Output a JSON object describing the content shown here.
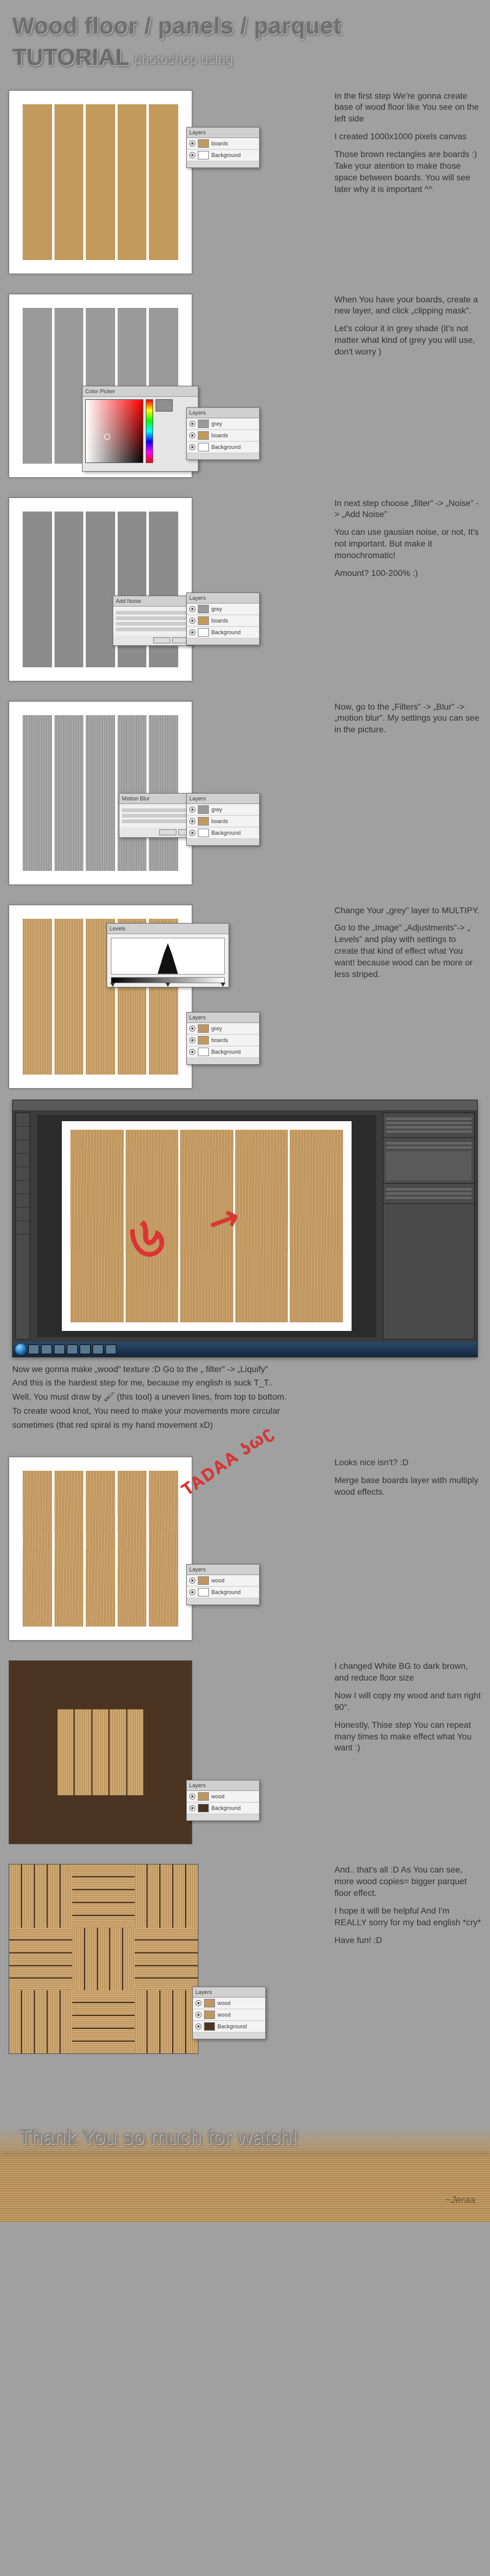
{
  "header": {
    "line1": "Wood floor / panels / parquet",
    "line2": "TUTORIAL",
    "sub": "photoshop using"
  },
  "steps": {
    "s1": {
      "p1": "In the first step We're gonna create base of wood floor like You see on the left side",
      "p2": "I created 1000x1000 pixels canvas",
      "p3": "Those brown rectangles are boards :) Take your atention to make those space between boards. You will see later why it is important ^^"
    },
    "s2": {
      "p1": "When You have your boards, create a new layer, and click „clipping mask”.",
      "p2": "Let's colour it in grey shade (it's not matter what kind of grey you will use, don't worry )"
    },
    "s3": {
      "p1": "In next step choose „filter” -> „Noise” -> „Add Noise”",
      "p2": "You can use gausian noise, or not, It's not important. But make it monochromatic!",
      "p3": "Amount? 100-200% :)"
    },
    "s4": {
      "p1": "Now, go to the „Filters” -> „Blur” -> „motion blur”. My settings you can see in the picture."
    },
    "s5": {
      "p1": "Change Your „grey” layer to MULTIPY.",
      "p2": "Go to the „Image” „Adjustments”-> „ Levels” and play with settings to create that kind of effect what You want! because wood can be more or less striped."
    },
    "s6_under": {
      "p1": "Now we gonna make „wood” texture :D Go to the „ filter” -> „Liquify”",
      "p2": "And this is the hardest step for me, because my english is suck T_T..",
      "p3": "Well, You must draw by 🖌 (this tool) a uneven lines, from top to bottom.",
      "p4": "To create wood knot, You need to make your movements more circular",
      "p5": "sometimes (that red spiral is my hand movement xD)"
    },
    "s7": {
      "tadaa": "TADAA ʖωʗ",
      "p1": "Looks nice isn't? :D",
      "p2": "Merge base boards layer with multiply wood effects."
    },
    "s8": {
      "p1": "I changed White BG to dark brown, and reduce floor size",
      "p2": "Now I will copy my wood and turn right 90°.",
      "p3": "Honestly, Thise step You can repeat many times to make effect what You want :)"
    },
    "s9": {
      "p1": "And.. that's all :D As You can see, more wood copies= bigger parquet floor effect.",
      "p2": "I hope it will be helpful And I'm REALLY sorry for my bad english *cry*",
      "p3": "Have fun! :D"
    }
  },
  "panels": {
    "layers_title": "Layers",
    "color_title": "Color Picker",
    "noise_title": "Add Noise",
    "motion_title": "Motion Blur",
    "levels_title": "Levels",
    "layer_names": {
      "boards": "boards",
      "grey": "grey",
      "bg": "Background",
      "wood": "wood"
    }
  },
  "spiral_char": "৬",
  "arrow_char": "↗",
  "footer": {
    "thanks": "Thank You so much for watch!",
    "sig": "~Jeraa"
  }
}
